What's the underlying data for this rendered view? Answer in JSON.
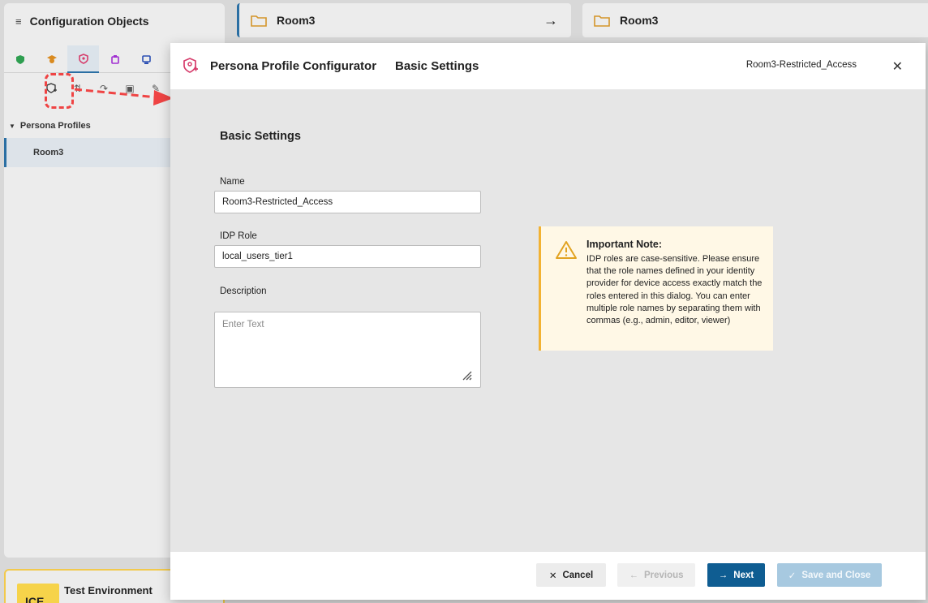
{
  "background": {
    "left_panel": {
      "title": "Configuration Objects",
      "section": "Persona Profiles",
      "selected_item": "Room3"
    },
    "mid_panel": {
      "title": "Room3"
    },
    "right_panel": {
      "title": "Room3"
    },
    "footer": {
      "title": "Test Environment",
      "logo_text": "ICE"
    }
  },
  "modal": {
    "title": "Persona Profile Configurator",
    "step": "Basic Settings",
    "profile_name": "Room3-Restricted_Access",
    "form": {
      "heading": "Basic Settings",
      "name_label": "Name",
      "name_value": "Room3-Restricted_Access",
      "idp_label": "IDP Role",
      "idp_value": "local_users_tier1",
      "description_label": "Description",
      "description_placeholder": "Enter Text"
    },
    "note": {
      "title": "Important Note:",
      "body": "IDP roles are case-sensitive. Please ensure that the role names defined in your identity provider for device access exactly match the roles entered in this dialog. You can enter multiple role names by separating them with commas (e.g., admin, editor, viewer)"
    },
    "footer": {
      "cancel": "Cancel",
      "previous": "Previous",
      "next": "Next",
      "save": "Save and Close"
    }
  },
  "colors": {
    "primary": "#0f5d92",
    "disabled_primary": "#a7c9e0",
    "note_bg": "#fff8e6",
    "note_accent": "#f2b233",
    "highlight": "#ef4444"
  }
}
